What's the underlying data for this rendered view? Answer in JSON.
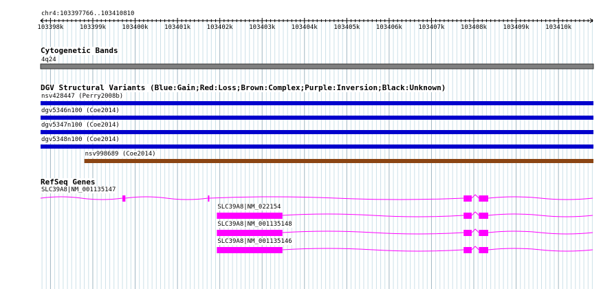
{
  "ruler": {
    "region": "chr4:103397766..103410810",
    "start": 103397766,
    "end": 103410810,
    "ticks": [
      {
        "pos": 103398000,
        "label": "103398k"
      },
      {
        "pos": 103399000,
        "label": "103399k"
      },
      {
        "pos": 103400000,
        "label": "103400k"
      },
      {
        "pos": 103401000,
        "label": "103401k"
      },
      {
        "pos": 103402000,
        "label": "103402k"
      },
      {
        "pos": 103403000,
        "label": "103403k"
      },
      {
        "pos": 103404000,
        "label": "103404k"
      },
      {
        "pos": 103405000,
        "label": "103405k"
      },
      {
        "pos": 103406000,
        "label": "103406k"
      },
      {
        "pos": 103407000,
        "label": "103407k"
      },
      {
        "pos": 103408000,
        "label": "103408k"
      },
      {
        "pos": 103409000,
        "label": "103409k"
      },
      {
        "pos": 103410000,
        "label": "103410k"
      }
    ]
  },
  "cytoband": {
    "title": "Cytogenetic Bands",
    "band_label": "4q24",
    "color": "#808080"
  },
  "dgv": {
    "title": "DGV Structural Variants (Blue:Gain;Red:Loss;Brown:Complex;Purple:Inversion;Black:Unknown)",
    "variants": [
      {
        "label": "nsv428447 (Perry2008b)",
        "start": 103397766,
        "end": 103410810,
        "color": "#0000cc"
      },
      {
        "label": "dgv5346n100 (Coe2014)",
        "start": 103397766,
        "end": 103410810,
        "color": "#0000cc"
      },
      {
        "label": "dgv5347n100 (Coe2014)",
        "start": 103397766,
        "end": 103410810,
        "color": "#0000cc"
      },
      {
        "label": "dgv5348n100 (Coe2014)",
        "start": 103397766,
        "end": 103410810,
        "color": "#0000cc"
      },
      {
        "label": "nsv998689 (Coe2014)",
        "start": 103398800,
        "end": 103410810,
        "color": "#8b4513"
      }
    ]
  },
  "refseq": {
    "title": "RefSeq Genes",
    "color": "#ff00ff",
    "genes": [
      {
        "label": "SLC39A8|NM_001135147",
        "start": 103397766,
        "end": 103410810,
        "exons": [
          [
            103399700,
            103399770
          ],
          [
            103401720,
            103401750
          ],
          [
            103407760,
            103407950
          ],
          [
            103408120,
            103408340
          ]
        ]
      },
      {
        "label": "SLC39A8|NM_022154",
        "start": 103401930,
        "end": 103410810,
        "exons": [
          [
            103401930,
            103403480
          ],
          [
            103407760,
            103407950
          ],
          [
            103408120,
            103408340
          ]
        ]
      },
      {
        "label": "SLC39A8|NM_001135148",
        "start": 103401930,
        "end": 103410810,
        "exons": [
          [
            103401930,
            103403480
          ],
          [
            103407760,
            103407950
          ],
          [
            103408120,
            103408340
          ]
        ]
      },
      {
        "label": "SLC39A8|NM_001135146",
        "start": 103401930,
        "end": 103410810,
        "exons": [
          [
            103401930,
            103403480
          ],
          [
            103407760,
            103407950
          ],
          [
            103408120,
            103408340
          ]
        ]
      }
    ]
  }
}
